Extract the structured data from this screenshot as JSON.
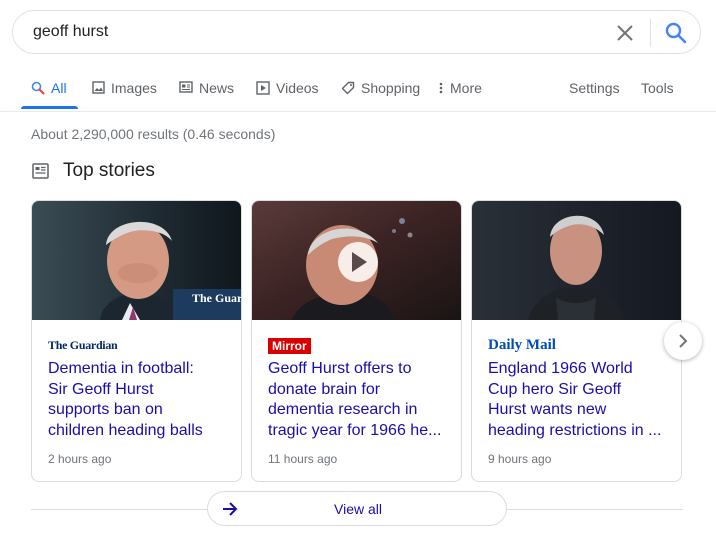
{
  "search": {
    "query": "geoff hurst"
  },
  "tabs": [
    {
      "label": "All"
    },
    {
      "label": "Images"
    },
    {
      "label": "News"
    },
    {
      "label": "Videos"
    },
    {
      "label": "Shopping"
    },
    {
      "label": "More"
    }
  ],
  "tools": {
    "settings": "Settings",
    "tools": "Tools"
  },
  "results_stats": "About 2,290,000 results (0.46 seconds)",
  "top_stories": {
    "title": "Top stories",
    "cards": [
      {
        "publisher": "The Guardian",
        "thumb_overlay": "The Guardian",
        "headline_lines": [
          "Dementia in football:",
          "Sir Geoff Hurst",
          "supports ban on",
          "children heading balls"
        ],
        "time": "2 hours ago"
      },
      {
        "publisher": "Mirror",
        "headline_lines": [
          "Geoff Hurst offers to",
          "donate brain for",
          "dementia research in",
          "tragic year for 1966 he..."
        ],
        "time": "11 hours ago",
        "has_video": true
      },
      {
        "publisher": "Daily Mail",
        "headline_lines": [
          "England 1966 World",
          "Cup hero Sir Geoff",
          "Hurst wants new",
          "heading restrictions in ..."
        ],
        "time": "9 hours ago"
      }
    ],
    "view_all": "View all"
  },
  "colors": {
    "accent": "#1a73e8",
    "link": "#1a0dab",
    "mirror_red": "#d80000",
    "dailymail_blue": "#004db3"
  }
}
